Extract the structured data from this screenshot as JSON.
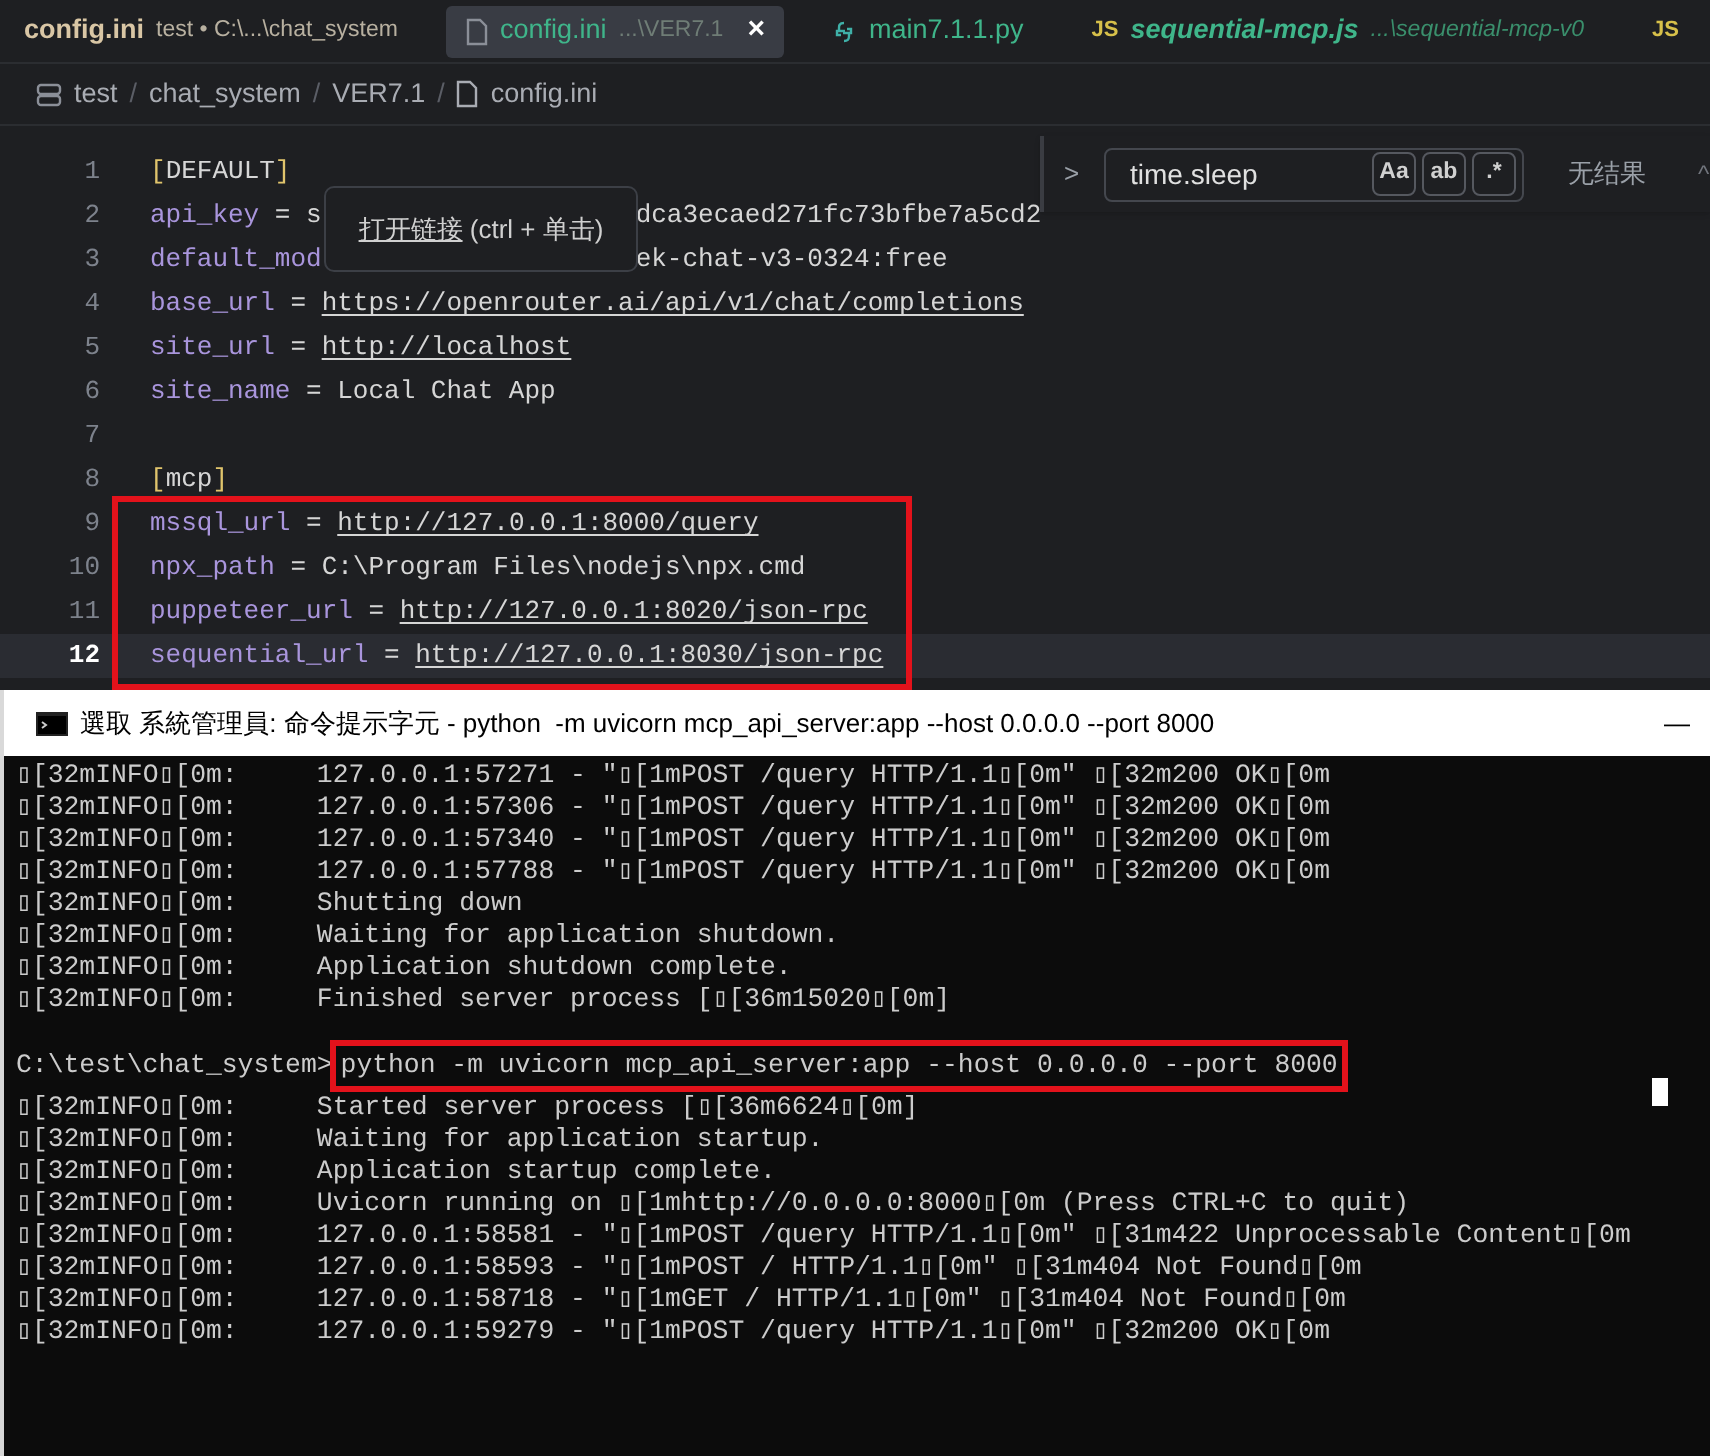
{
  "tabs": [
    {
      "kind": "text",
      "label": "config.ini",
      "detail": "test • C:\\...\\chat_system",
      "selected": false
    },
    {
      "kind": "file",
      "label": "config.ini",
      "detail": "...\\VER7.1",
      "close": "×",
      "selected": true
    },
    {
      "kind": "python",
      "label": "main7.1.1.py",
      "selected": false
    },
    {
      "kind": "js",
      "icon_text": "JS",
      "label": "sequential-mcp.js",
      "detail": "...\\sequential-mcp-v0",
      "selected": false
    },
    {
      "kind": "js",
      "icon_text": "JS",
      "selected": false
    }
  ],
  "breadcrumb": [
    {
      "kind": "folder",
      "label": "test"
    },
    {
      "kind": "folder",
      "label": "chat_system"
    },
    {
      "kind": "folder",
      "label": "VER7.1"
    },
    {
      "kind": "file",
      "label": "config.ini"
    }
  ],
  "breadcrumb_separator": "/",
  "editor": {
    "lines": [
      {
        "number": "1",
        "current": false,
        "parts": [
          {
            "kind": "bracket",
            "text": "["
          },
          {
            "kind": "value",
            "text": "DEFAULT"
          },
          {
            "kind": "bracket",
            "text": "]"
          }
        ]
      },
      {
        "number": "2",
        "current": false,
        "parts": [
          {
            "kind": "key",
            "text": "api_key"
          },
          {
            "kind": "value",
            "text": " = s"
          },
          {
            "kind": "value",
            "text": "dca3ecaed271fc73bfbe7a5cd2",
            "after_tooltip": true
          }
        ]
      },
      {
        "number": "3",
        "current": false,
        "parts": [
          {
            "kind": "key",
            "text": "default_mod"
          },
          {
            "kind": "value",
            "text": "ek-chat-v3-0324:free",
            "after_tooltip": true
          }
        ]
      },
      {
        "number": "4",
        "current": false,
        "parts": [
          {
            "kind": "key",
            "text": "base_url"
          },
          {
            "kind": "value",
            "text": " = "
          },
          {
            "kind": "link",
            "text": "https://openrouter.ai/api/v1/chat/completions"
          }
        ]
      },
      {
        "number": "5",
        "current": false,
        "parts": [
          {
            "kind": "key",
            "text": "site_url"
          },
          {
            "kind": "value",
            "text": " = "
          },
          {
            "kind": "link",
            "text": "http://localhost"
          }
        ]
      },
      {
        "number": "6",
        "current": false,
        "parts": [
          {
            "kind": "key",
            "text": "site_name"
          },
          {
            "kind": "value",
            "text": " = Local Chat App"
          }
        ]
      },
      {
        "number": "7",
        "current": false
      },
      {
        "number": "8",
        "current": false,
        "parts": [
          {
            "kind": "bracket",
            "text": "["
          },
          {
            "kind": "value",
            "text": "mcp"
          },
          {
            "kind": "bracket",
            "text": "]"
          }
        ]
      }
    ],
    "framed_lines": [
      {
        "number": "9",
        "current": false,
        "parts": [
          {
            "kind": "key",
            "text": "mssql_url"
          },
          {
            "kind": "value",
            "text": " = "
          },
          {
            "kind": "link",
            "text": "http://127.0.0.1:8000/query"
          }
        ]
      },
      {
        "number": "10",
        "current": false,
        "parts": [
          {
            "kind": "key",
            "text": "npx_path"
          },
          {
            "kind": "value",
            "text": " = C:\\Program Files\\nodejs\\npx.cmd"
          }
        ]
      },
      {
        "number": "11",
        "current": false,
        "parts": [
          {
            "kind": "key",
            "text": "puppeteer_url"
          },
          {
            "kind": "value",
            "text": " = "
          },
          {
            "kind": "link",
            "text": "http://127.0.0.1:8020/json-rpc"
          }
        ]
      },
      {
        "number": "12",
        "current": true,
        "parts": [
          {
            "kind": "key",
            "text": "sequential_url"
          },
          {
            "kind": "value",
            "text": " = "
          },
          {
            "kind": "link",
            "text": "http://127.0.0.1:8030/json-rpc"
          }
        ]
      }
    ]
  },
  "tooltip": {
    "link": "打开链接",
    "hint": " (ctrl + 单击)"
  },
  "find": {
    "toggle": ">",
    "value": "time.sleep",
    "options": [
      {
        "label": "Aa",
        "on": false
      },
      {
        "label": "ab",
        "on": false
      },
      {
        "label": ".*",
        "on": false
      }
    ],
    "result": "无结果",
    "prev": "^"
  },
  "terminal": {
    "title": "選取 系統管理員: 命令提示字元 - python  -m uvicorn mcp_api_server:app --host 0.0.0.0 --port 8000",
    "minimize": "—",
    "lines": [
      {
        "kind": "output",
        "text": "▯[32mINFO▯[0m:     127.0.0.1:57271 - \"▯[1mPOST /query HTTP/1.1▯[0m\" ▯[32m200 OK▯[0m"
      },
      {
        "kind": "output",
        "text": "▯[32mINFO▯[0m:     127.0.0.1:57306 - \"▯[1mPOST /query HTTP/1.1▯[0m\" ▯[32m200 OK▯[0m"
      },
      {
        "kind": "output",
        "text": "▯[32mINFO▯[0m:     127.0.0.1:57340 - \"▯[1mPOST /query HTTP/1.1▯[0m\" ▯[32m200 OK▯[0m"
      },
      {
        "kind": "output",
        "text": "▯[32mINFO▯[0m:     127.0.0.1:57788 - \"▯[1mPOST /query HTTP/1.1▯[0m\" ▯[32m200 OK▯[0m"
      },
      {
        "kind": "output",
        "text": "▯[32mINFO▯[0m:     Shutting down"
      },
      {
        "kind": "output",
        "text": "▯[32mINFO▯[0m:     Waiting for application shutdown."
      },
      {
        "kind": "output",
        "text": "▯[32mINFO▯[0m:     Application shutdown complete."
      },
      {
        "kind": "output",
        "text": "▯[32mINFO▯[0m:     Finished server process [▯[36m15020▯[0m]"
      },
      {
        "kind": "blank"
      },
      {
        "kind": "framed_prompt",
        "prompt": "C:\\test\\chat_system>",
        "command": "python -m uvicorn mcp_api_server:app --host 0.0.0.0 --port 8000"
      },
      {
        "kind": "output",
        "text": "▯[32mINFO▯[0m:     Started server process [▯[36m6624▯[0m]"
      },
      {
        "kind": "output",
        "text": "▯[32mINFO▯[0m:     Waiting for application startup."
      },
      {
        "kind": "output",
        "text": "▯[32mINFO▯[0m:     Application startup complete."
      },
      {
        "kind": "output",
        "text": "▯[32mINFO▯[0m:     Uvicorn running on ▯[1mhttp://0.0.0.0:8000▯[0m (Press CTRL+C to quit)"
      },
      {
        "kind": "output",
        "text": "▯[32mINFO▯[0m:     127.0.0.1:58581 - \"▯[1mPOST /query HTTP/1.1▯[0m\" ▯[31m422 Unprocessable Content▯[0m"
      },
      {
        "kind": "output",
        "text": "▯[32mINFO▯[0m:     127.0.0.1:58593 - \"▯[1mPOST / HTTP/1.1▯[0m\" ▯[31m404 Not Found▯[0m"
      },
      {
        "kind": "output",
        "text": "▯[32mINFO▯[0m:     127.0.0.1:58718 - \"▯[1mGET / HTTP/1.1▯[0m\" ▯[31m404 Not Found▯[0m"
      },
      {
        "kind": "output",
        "text": "▯[32mINFO▯[0m:     127.0.0.1:59279 - \"▯[1mPOST /query HTTP/1.1▯[0m\" ▯[32m200 OK▯[0m"
      }
    ]
  }
}
